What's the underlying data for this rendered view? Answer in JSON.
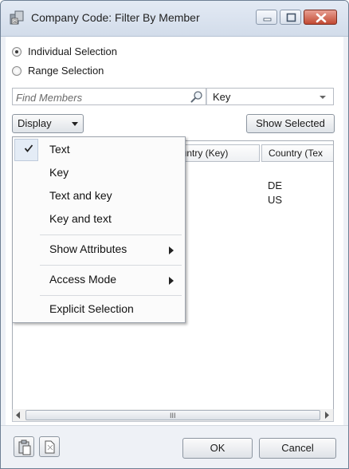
{
  "window": {
    "title": "Company Code: Filter By Member"
  },
  "selection_mode": {
    "options": [
      {
        "label": "Individual Selection",
        "checked": true
      },
      {
        "label": "Range Selection",
        "checked": false
      }
    ]
  },
  "search": {
    "placeholder": "Find Members",
    "field": "Key"
  },
  "toolbar": {
    "display_label": "Display",
    "show_selected_label": "Show Selected"
  },
  "list": {
    "columns": [
      "ountry (Key)",
      "Country (Tex"
    ],
    "rows": [
      {
        "key": "",
        "text": "DE"
      },
      {
        "key": "",
        "text": "US"
      }
    ],
    "hscroll_grip": "III"
  },
  "display_menu": {
    "items": [
      {
        "label": "Text",
        "checked": true,
        "submenu": false
      },
      {
        "label": "Key",
        "checked": false,
        "submenu": false
      },
      {
        "label": "Text and key",
        "checked": false,
        "submenu": false
      },
      {
        "label": "Key and text",
        "checked": false,
        "submenu": false
      },
      {
        "label": "Show Attributes",
        "checked": false,
        "submenu": true
      },
      {
        "label": "Access Mode",
        "checked": false,
        "submenu": true
      },
      {
        "label": "Explicit Selection",
        "checked": false,
        "submenu": false
      }
    ]
  },
  "footer": {
    "ok_label": "OK",
    "cancel_label": "Cancel"
  },
  "colors": {
    "title_bar": "#d2dcea",
    "close_button": "#c24a33",
    "menu_background": "#fbfbfb"
  }
}
